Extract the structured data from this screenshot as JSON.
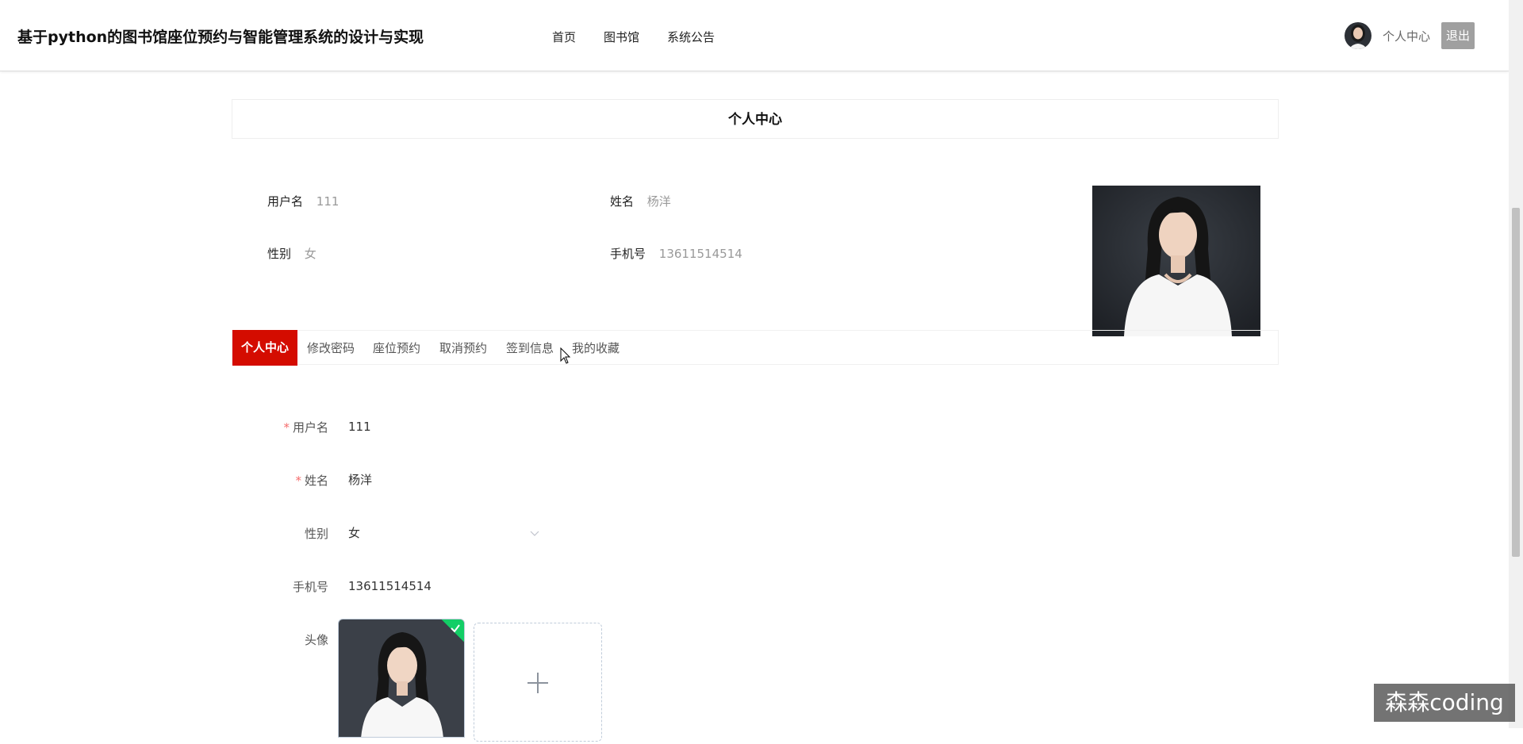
{
  "header": {
    "site_title": "基于python的图书馆座位预约与智能管理系统的设计与实现",
    "nav": [
      "首页",
      "图书馆",
      "系统公告"
    ],
    "profile_link": "个人中心",
    "logout_label": "退出"
  },
  "page_title": "个人中心",
  "profile": {
    "username_label": "用户名",
    "username_value": "111",
    "name_label": "姓名",
    "name_value": "杨洋",
    "gender_label": "性别",
    "gender_value": "女",
    "phone_label": "手机号",
    "phone_value": "13611514514"
  },
  "tabs": [
    "个人中心",
    "修改密码",
    "座位预约",
    "取消预约",
    "签到信息",
    "我的收藏"
  ],
  "active_tab": "个人中心",
  "form": {
    "username_label": "用户名",
    "username_value": "111",
    "name_label": "姓名",
    "name_value": "杨洋",
    "gender_label": "性别",
    "gender_value": "女",
    "phone_label": "手机号",
    "phone_value": "13611514514",
    "avatar_label": "头像",
    "required_mark": "*",
    "upload_add_symbol": "+"
  },
  "watermark": "森森coding",
  "colors": {
    "active_tab": "#d40c00",
    "required": "#f56c6c",
    "upload_success": "#13ce66",
    "logout_bg": "#a0a0a0"
  }
}
